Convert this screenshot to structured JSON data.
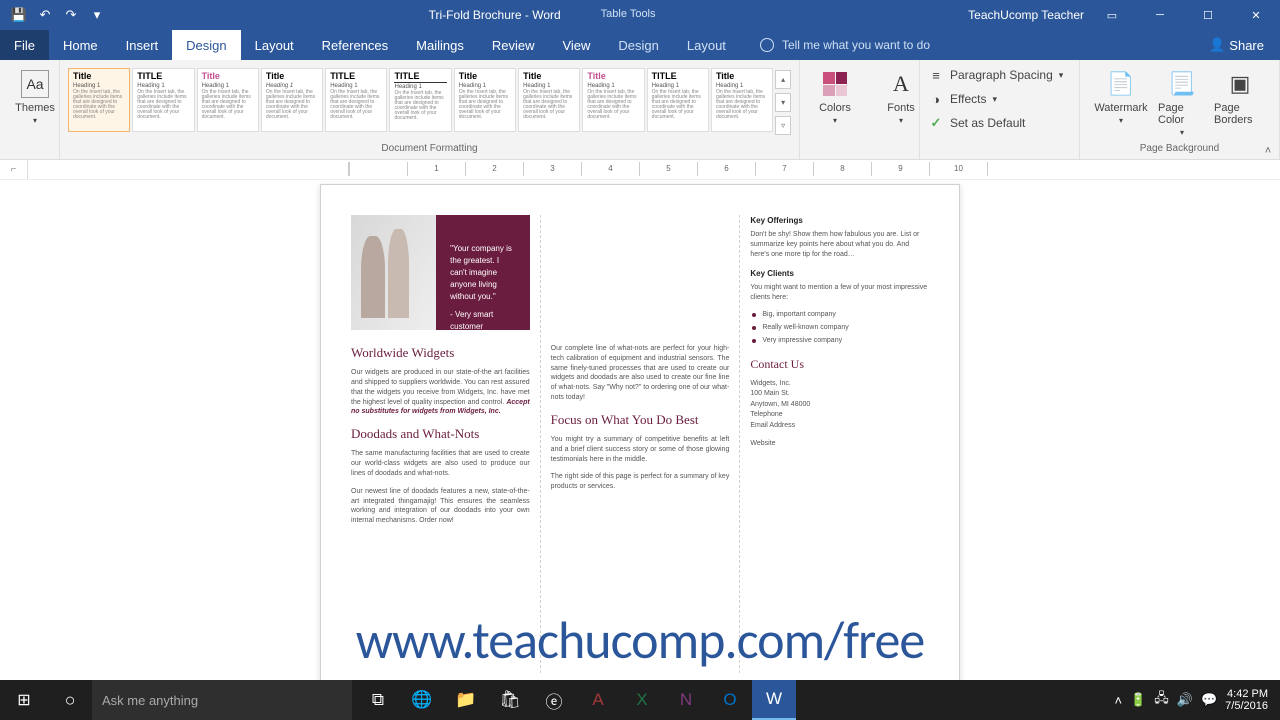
{
  "titlebar": {
    "doc_title": "Tri-Fold Brochure - Word",
    "table_tools": "Table Tools",
    "user": "TeachUcomp Teacher"
  },
  "tabs": {
    "file": "File",
    "home": "Home",
    "insert": "Insert",
    "design": "Design",
    "layout": "Layout",
    "references": "References",
    "mailings": "Mailings",
    "review": "Review",
    "view": "View",
    "t_design": "Design",
    "t_layout": "Layout",
    "tellme": "Tell me what you want to do",
    "share": "Share"
  },
  "ribbon": {
    "themes": "Themes",
    "colors": "Colors",
    "fonts": "Fonts",
    "paragraph_spacing": "Paragraph Spacing",
    "effects": "Effects",
    "set_default": "Set as Default",
    "watermark": "Watermark",
    "page_color": "Page Color",
    "page_borders": "Page Borders",
    "grp_docfmt": "Document Formatting",
    "grp_pagebg": "Page Background",
    "gal_titles": [
      "Title",
      "TITLE",
      "Title",
      "Title",
      "TITLE",
      "TITLE",
      "Title",
      "Title",
      "Title",
      "TITLE",
      "Title"
    ],
    "gal_heading": "Heading 1",
    "gal_body": "On the Insert tab, the galleries include items that are designed to coordinate with the overall look of your document."
  },
  "ruler": {
    "marks": [
      "1",
      "2",
      "3",
      "4",
      "5",
      "6",
      "7",
      "8",
      "9",
      "10"
    ]
  },
  "doc": {
    "quote": "\"Your company is the greatest. I can't imagine anyone living without you.\"",
    "quote_attr": "- Very smart customer",
    "p1_h1": "Worldwide Widgets",
    "p1_t1": "Our widgets are produced in our state-of-the art facilities and shipped to suppliers worldwide. You can rest assured that the widgets you receive from Widgets, Inc. have met the highest level of quality inspection and control.",
    "p1_em": "Accept no substitutes for widgets from Widgets, Inc.",
    "p1_h2": "Doodads and What-Nots",
    "p1_t2": "The same manufacturing facilities that are used to create our world-class widgets are also used to produce our lines of doodads and what-nots.",
    "p1_t3": "Our newest line of doodads features a new, state-of-the-art integrated thingamajig! This ensures the seamless working and integration of our doodads into your own internal mechanisms. Order now!",
    "p2_t1": "Our complete line of what-nots are perfect for your high-tech calibration of equipment and industrial sensors. The same finely-tuned processes that are used to create our widgets and doodads are also used to create our fine line of what-nots. Say \"Why not?\" to ordering one of our what-nots today!",
    "p2_h1": "Focus on What You Do Best",
    "p2_t2": "You might try a summary of competitive benefits at left and a brief client success story or some of those glowing testimonials here in the middle.",
    "p2_t3": "The right side of this page is perfect for a summary of key products or services.",
    "p3_h1": "Key Offerings",
    "p3_t1": "Don't be shy! Show them how fabulous you are. List or summarize key points here about what you do. And here's one more tip for the road…",
    "p3_h2": "Key Clients",
    "p3_t2": "You might want to mention a few of your most impressive clients here:",
    "p3_bullets": [
      "Big, important company",
      "Really well-known company",
      "Very impressive company"
    ],
    "p3_contact": "Contact Us",
    "p3_addr": [
      "Widgets, Inc.",
      "100 Main St.",
      "Anytown, MI 48000",
      "Telephone",
      "Email Address"
    ],
    "p3_web": "Website"
  },
  "watermark_url": "www.teachucomp.com/free",
  "taskbar": {
    "search": "Ask me anything",
    "time": "4:42 PM",
    "date": "7/5/2016"
  }
}
